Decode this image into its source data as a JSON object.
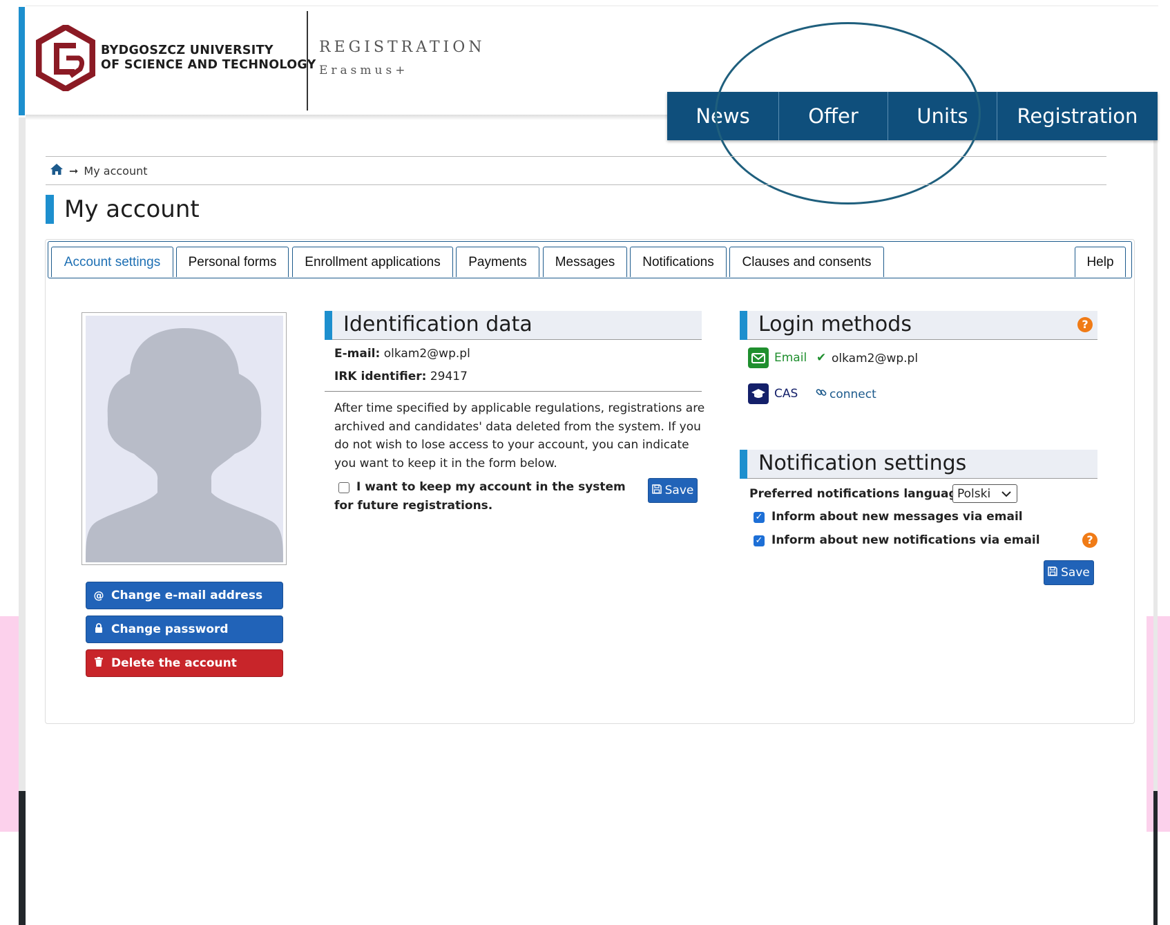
{
  "header": {
    "university_line1": "BYDGOSZCZ UNIVERSITY",
    "university_line2": "OF SCIENCE AND TECHNOLOGY",
    "registration_title": "REGISTRATION",
    "registration_sub": "Erasmus+"
  },
  "nav": {
    "items": [
      {
        "label": "News"
      },
      {
        "label": "Offer"
      },
      {
        "label": "Units"
      },
      {
        "label": "Registration"
      }
    ]
  },
  "breadcrumb": {
    "current": "My account"
  },
  "page_title": "My account",
  "tabs": [
    {
      "label": "Account settings",
      "active": true
    },
    {
      "label": "Personal forms"
    },
    {
      "label": "Enrollment applications"
    },
    {
      "label": "Payments"
    },
    {
      "label": "Messages"
    },
    {
      "label": "Notifications"
    },
    {
      "label": "Clauses and consents"
    },
    {
      "label": "Help"
    }
  ],
  "account_buttons": {
    "change_email": "Change e-mail address",
    "change_password": "Change password",
    "delete_account": "Delete the account"
  },
  "identification": {
    "title": "Identification data",
    "email_label": "E-mail:",
    "email_value": "olkam2@wp.pl",
    "irk_label": "IRK identifier:",
    "irk_value": "29417",
    "info_text": "After time specified by applicable regulations, registrations are archived and candidates' data deleted from the system. If you do not wish to lose access to your account, you can indicate you want to keep it in the form below.",
    "keep_account_label": "I want to keep my account in the system for future registrations.",
    "keep_account_checked": false,
    "save_label": "Save"
  },
  "login_methods": {
    "title": "Login methods",
    "email_method_label": "Email",
    "email_method_value": "olkam2@wp.pl",
    "cas_method_label": "CAS",
    "cas_connect_label": "connect"
  },
  "notification_settings": {
    "title": "Notification settings",
    "language_label": "Preferred notifications language:",
    "language_value": "Polski",
    "messages_label": "Inform about new messages via email",
    "messages_checked": true,
    "notifications_label": "Inform about new notifications via email",
    "notifications_checked": true,
    "save_label": "Save"
  },
  "colors": {
    "accent": "#1d8fce",
    "nav_bg": "#0f4f7c",
    "button_blue": "#2163b8",
    "button_red": "#c8252a",
    "logo": "#8b1a24",
    "help_orange": "#f07b16"
  }
}
